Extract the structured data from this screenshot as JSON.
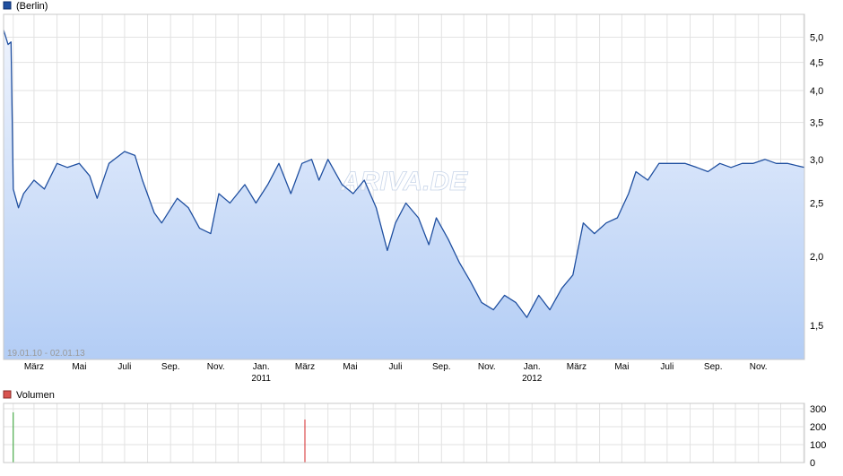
{
  "price_legend": {
    "label": "(Berlin)",
    "color": "#1f4fa0"
  },
  "volume_legend": {
    "label": "Volumen",
    "color": "#d9534f"
  },
  "date_range": "19.01.10 - 02.01.13",
  "watermark": "ARIVA.DE",
  "x_month_labels": [
    "März",
    "Mai",
    "Juli",
    "Sep.",
    "Nov.",
    "Jan.",
    "März",
    "Mai",
    "Juli",
    "Sep.",
    "Nov.",
    "Jan.",
    "März",
    "Mai",
    "Juli",
    "Sep.",
    "Nov."
  ],
  "x_year_labels": [
    "2011",
    "2012"
  ],
  "chart_data": [
    {
      "type": "line",
      "scale": "log",
      "title": "(Berlin)",
      "y_ticks": [
        "1,5",
        "2,0",
        "2,5",
        "3,0",
        "3,5",
        "4,0",
        "4,5",
        "5,0"
      ],
      "ylim": [
        1.3,
        5.5
      ],
      "grid": true,
      "series": [
        {
          "name": "(Berlin)",
          "points": [
            [
              "2010-01-19",
              5.15
            ],
            [
              "2010-01-25",
              4.85
            ],
            [
              "2010-01-29",
              4.9
            ],
            [
              "2010-02-01",
              2.65
            ],
            [
              "2010-02-08",
              2.45
            ],
            [
              "2010-02-15",
              2.6
            ],
            [
              "2010-03-01",
              2.75
            ],
            [
              "2010-03-15",
              2.65
            ],
            [
              "2010-04-01",
              2.95
            ],
            [
              "2010-04-15",
              2.9
            ],
            [
              "2010-05-01",
              2.95
            ],
            [
              "2010-05-15",
              2.8
            ],
            [
              "2010-05-25",
              2.55
            ],
            [
              "2010-06-10",
              2.95
            ],
            [
              "2010-07-01",
              3.1
            ],
            [
              "2010-07-15",
              3.05
            ],
            [
              "2010-07-25",
              2.75
            ],
            [
              "2010-08-10",
              2.4
            ],
            [
              "2010-08-20",
              2.3
            ],
            [
              "2010-09-10",
              2.55
            ],
            [
              "2010-09-25",
              2.45
            ],
            [
              "2010-10-10",
              2.25
            ],
            [
              "2010-10-25",
              2.2
            ],
            [
              "2010-11-05",
              2.6
            ],
            [
              "2010-11-20",
              2.5
            ],
            [
              "2010-12-10",
              2.7
            ],
            [
              "2010-12-25",
              2.5
            ],
            [
              "2011-01-10",
              2.7
            ],
            [
              "2011-01-25",
              2.95
            ],
            [
              "2011-02-10",
              2.6
            ],
            [
              "2011-02-25",
              2.95
            ],
            [
              "2011-03-10",
              3.0
            ],
            [
              "2011-03-20",
              2.75
            ],
            [
              "2011-04-01",
              3.0
            ],
            [
              "2011-04-20",
              2.7
            ],
            [
              "2011-05-05",
              2.6
            ],
            [
              "2011-05-20",
              2.75
            ],
            [
              "2011-06-05",
              2.45
            ],
            [
              "2011-06-20",
              2.05
            ],
            [
              "2011-07-01",
              2.3
            ],
            [
              "2011-07-15",
              2.5
            ],
            [
              "2011-08-01",
              2.35
            ],
            [
              "2011-08-15",
              2.1
            ],
            [
              "2011-08-25",
              2.35
            ],
            [
              "2011-09-10",
              2.15
            ],
            [
              "2011-09-25",
              1.95
            ],
            [
              "2011-10-10",
              1.8
            ],
            [
              "2011-10-25",
              1.65
            ],
            [
              "2011-11-10",
              1.6
            ],
            [
              "2011-11-25",
              1.7
            ],
            [
              "2011-12-10",
              1.65
            ],
            [
              "2011-12-25",
              1.55
            ],
            [
              "2012-01-10",
              1.7
            ],
            [
              "2012-01-25",
              1.6
            ],
            [
              "2012-02-10",
              1.75
            ],
            [
              "2012-02-25",
              1.85
            ],
            [
              "2012-03-10",
              2.3
            ],
            [
              "2012-03-25",
              2.2
            ],
            [
              "2012-04-10",
              2.3
            ],
            [
              "2012-04-25",
              2.35
            ],
            [
              "2012-05-10",
              2.6
            ],
            [
              "2012-05-20",
              2.85
            ],
            [
              "2012-06-05",
              2.75
            ],
            [
              "2012-06-20",
              2.95
            ],
            [
              "2012-07-10",
              2.95
            ],
            [
              "2012-07-25",
              2.95
            ],
            [
              "2012-08-10",
              2.9
            ],
            [
              "2012-08-25",
              2.85
            ],
            [
              "2012-09-10",
              2.95
            ],
            [
              "2012-09-25",
              2.9
            ],
            [
              "2012-10-10",
              2.95
            ],
            [
              "2012-10-25",
              2.95
            ],
            [
              "2012-11-10",
              3.0
            ],
            [
              "2012-11-25",
              2.95
            ],
            [
              "2012-12-10",
              2.95
            ],
            [
              "2013-01-02",
              2.9
            ]
          ]
        }
      ]
    },
    {
      "type": "bar",
      "title": "Volumen",
      "y_ticks": [
        "0",
        "100",
        "200",
        "300"
      ],
      "ylim": [
        0,
        300
      ],
      "grid": true,
      "series": [
        {
          "name": "Volumen",
          "points": [
            [
              "2010-02-01",
              280,
              "#2ca02c"
            ],
            [
              "2011-03-01",
              240,
              "#d62728"
            ]
          ]
        }
      ]
    }
  ]
}
